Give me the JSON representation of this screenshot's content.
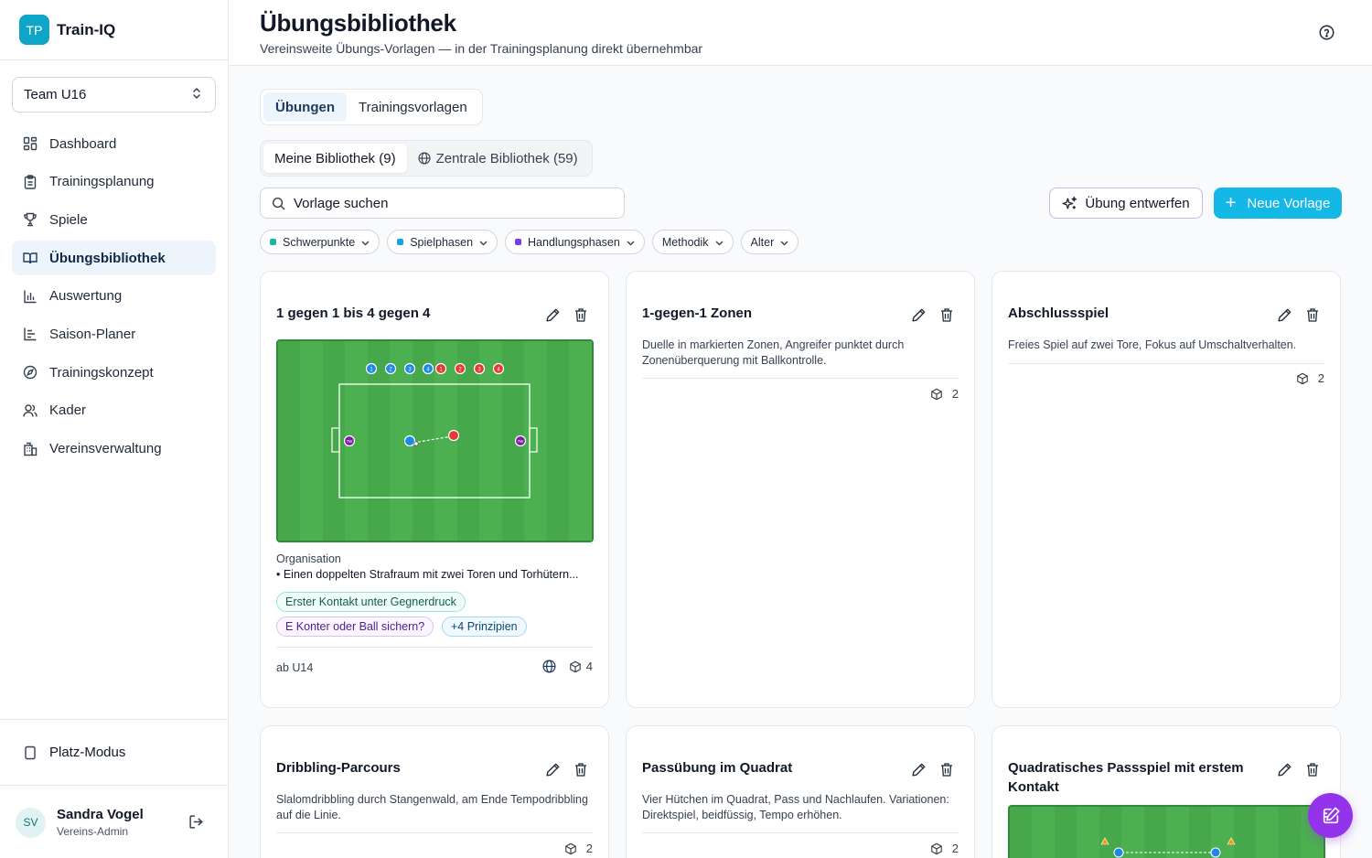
{
  "brand": {
    "logo": "TP",
    "name": "Train-IQ"
  },
  "team_selector": {
    "value": "Team U16"
  },
  "nav": [
    {
      "label": "Dashboard",
      "icon": "dashboard-icon"
    },
    {
      "label": "Trainingsplanung",
      "icon": "clipboard-icon"
    },
    {
      "label": "Spiele",
      "icon": "trophy-icon"
    },
    {
      "label": "Übungsbibliothek",
      "icon": "book-icon",
      "active": true
    },
    {
      "label": "Auswertung",
      "icon": "bar-chart-icon"
    },
    {
      "label": "Saison-Planer",
      "icon": "timeline-icon"
    },
    {
      "label": "Trainingskonzept",
      "icon": "compass-icon"
    },
    {
      "label": "Kader",
      "icon": "users-icon"
    },
    {
      "label": "Vereinsverwaltung",
      "icon": "building-icon"
    }
  ],
  "platz_mode": {
    "label": "Platz-Modus"
  },
  "user": {
    "initials": "SV",
    "name": "Sandra Vogel",
    "role": "Vereins-Admin"
  },
  "header": {
    "title": "Übungsbibliothek",
    "subtitle": "Vereinsweite Übungs-Vorlagen — in der Trainingsplanung direkt übernehmbar"
  },
  "tabs": [
    {
      "label": "Übungen",
      "active": true
    },
    {
      "label": "Trainingsvorlagen"
    }
  ],
  "library_tabs": [
    {
      "label": "Meine Bibliothek (9)",
      "active": true
    },
    {
      "label": "Zentrale Bibliothek (59)"
    }
  ],
  "search": {
    "placeholder": "Vorlage suchen",
    "value": ""
  },
  "buttons": {
    "design": "Übung entwerfen",
    "new": "Neue Vorlage"
  },
  "filters": [
    {
      "label": "Schwerpunkte",
      "color": "#14b8a6"
    },
    {
      "label": "Spielphasen",
      "color": "#0ea5e9"
    },
    {
      "label": "Handlungsphasen",
      "color": "#7c3aed"
    },
    {
      "label": "Methodik"
    },
    {
      "label": "Alter"
    }
  ],
  "cards": [
    {
      "title": "1 gegen 1 bis 4 gegen 4",
      "org_label": "Organisation",
      "org_text": "• Einen doppelten Strafraum mit zwei Toren und Torhütern...",
      "tags": [
        "Erster Kontakt unter Gegnerdruck",
        "E Konter oder Ball sichern?",
        "+4 Prinzipien"
      ],
      "age": "ab U14",
      "count": "4",
      "field_players": {
        "blue": [
          "1",
          "2",
          "3",
          "4"
        ],
        "red": [
          "1",
          "2",
          "3",
          "4"
        ],
        "goalkeeper": "TW"
      }
    },
    {
      "title": "1-gegen-1 Zonen",
      "description": "Duelle in markierten Zonen, Angreifer punktet durch Zonenüberquerung mit Ballkontrolle.",
      "count": "2"
    },
    {
      "title": "Abschlussspiel",
      "description": "Freies Spiel auf zwei Tore, Fokus auf Umschaltverhalten.",
      "count": "2"
    },
    {
      "title": "Dribbling-Parcours",
      "description": "Slalomdribbling durch Stangenwald, am Ende Tempodribbling auf die Linie.",
      "count": "2"
    },
    {
      "title": "Passübung im Quadrat",
      "description": "Vier Hütchen im Quadrat, Pass und Nachlaufen. Variationen: Direktspiel, beidfüssig, Tempo erhöhen.",
      "count": "2"
    },
    {
      "title": "Quadratisches Passspiel mit erstem Kontakt"
    }
  ]
}
